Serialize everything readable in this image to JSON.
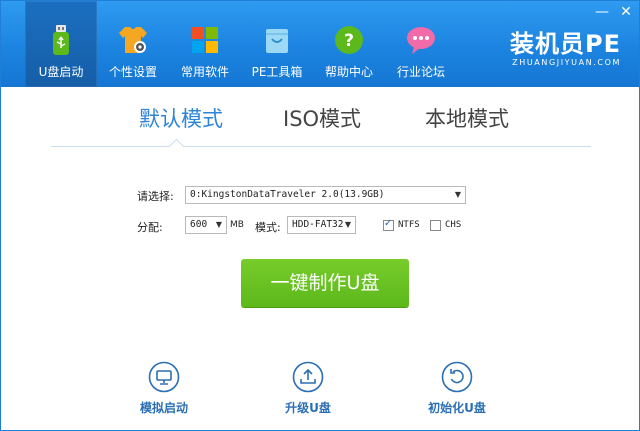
{
  "window": {
    "minimize_label": "—",
    "close_label": "✕"
  },
  "nav": {
    "items": [
      {
        "label": "U盘启动",
        "icon": "usb-drive-icon"
      },
      {
        "label": "个性设置",
        "icon": "tshirt-gear-icon"
      },
      {
        "label": "常用软件",
        "icon": "windows-tiles-icon"
      },
      {
        "label": "PE工具箱",
        "icon": "shopping-bag-icon"
      },
      {
        "label": "帮助中心",
        "icon": "help-question-icon"
      },
      {
        "label": "行业论坛",
        "icon": "chat-bubble-icon"
      }
    ],
    "active_index": 0
  },
  "logo": {
    "main": "装机员PE",
    "sub": "ZHUANGJIYUAN.COM"
  },
  "tabs": [
    {
      "label": "默认模式",
      "active": true
    },
    {
      "label": "ISO模式",
      "active": false
    },
    {
      "label": "本地模式",
      "active": false
    }
  ],
  "form": {
    "device_label": "请选择:",
    "device_value": "0:KingstonDataTraveler 2.0(13.9GB)",
    "alloc_label": "分配:",
    "alloc_value": "600",
    "alloc_unit": "MB",
    "mode_label": "模式:",
    "mode_value": "HDD-FAT32",
    "ntfs_label": "NTFS",
    "ntfs_checked": true,
    "chs_label": "CHS",
    "chs_checked": false
  },
  "primary_button": {
    "label": "一键制作U盘",
    "color": "#6cc223"
  },
  "actions": [
    {
      "label": "模拟启动",
      "icon": "monitor-icon"
    },
    {
      "label": "升级U盘",
      "icon": "upload-icon"
    },
    {
      "label": "初始化U盘",
      "icon": "restore-icon"
    }
  ],
  "colors": {
    "header": "#1c84e0",
    "accent": "#2d84d8",
    "action_text": "#2b6fb4"
  }
}
